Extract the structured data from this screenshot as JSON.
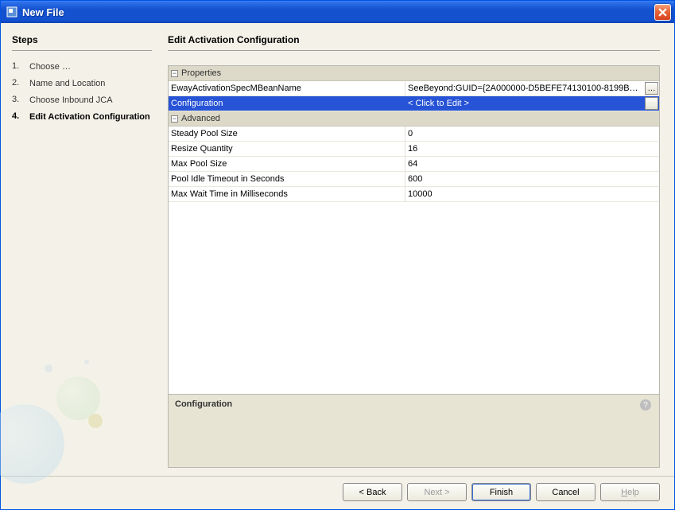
{
  "window": {
    "title": "New File"
  },
  "sidebar": {
    "heading": "Steps",
    "steps": [
      {
        "num": "1.",
        "label": "Choose …"
      },
      {
        "num": "2.",
        "label": "Name and Location"
      },
      {
        "num": "3.",
        "label": "Choose Inbound JCA"
      },
      {
        "num": "4.",
        "label": "Edit Activation Configuration"
      }
    ]
  },
  "panel": {
    "title": "Edit Activation Configuration",
    "groups": {
      "properties_label": "Properties",
      "advanced_label": "Advanced"
    },
    "rows": {
      "eway_name": "EwayActivationSpecMBeanName",
      "eway_value": "SeeBeyond:GUID={2A000000-D5BEFE74130100-8199B…",
      "config_name": "Configuration",
      "config_value": "< Click to Edit >",
      "steady_name": "Steady Pool Size",
      "steady_value": "0",
      "resize_name": "Resize Quantity",
      "resize_value": "16",
      "maxpool_name": "Max Pool Size",
      "maxpool_value": "64",
      "idle_name": "Pool Idle Timeout in Seconds",
      "idle_value": "600",
      "maxwait_name": "Max Wait Time in Milliseconds",
      "maxwait_value": "10000"
    },
    "description_title": "Configuration"
  },
  "buttons": {
    "back": "< Back",
    "next": "Next >",
    "finish": "Finish",
    "cancel": "Cancel",
    "help": "Help"
  }
}
